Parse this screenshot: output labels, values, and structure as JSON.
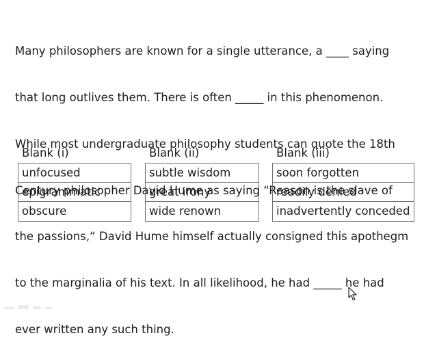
{
  "passage": {
    "lines": [
      "Many philosophers are known for a single utterance, a ____ saying",
      "that long outlives them. There is often _____ in this phenomenon.",
      "While most undergraduate philosophy students can quote the 18th",
      "Century philosopher David Hume as saying “Reason is the slave of",
      "the passions,“ David Hume himself actually consigned this apothegm",
      "to the marginalia of his text. In all likelihood, he had _____ he had",
      "ever written any such thing."
    ]
  },
  "blanks": [
    {
      "heading": "Blank (i)",
      "options": [
        "unfocused",
        "epigrammatic",
        "obscure"
      ]
    },
    {
      "heading": "Blank (ii)",
      "options": [
        "subtle wisdom",
        "great irony",
        "wide renown"
      ]
    },
    {
      "heading": "Blank (iii)",
      "options": [
        "soon forgotten",
        "readily denied",
        "inadvertently conceded"
      ]
    }
  ],
  "cursor_icon": "mouse-pointer-icon",
  "colors": {
    "text": "#1c1c1c",
    "border": "#6e6e6e",
    "background": "#ffffff"
  }
}
